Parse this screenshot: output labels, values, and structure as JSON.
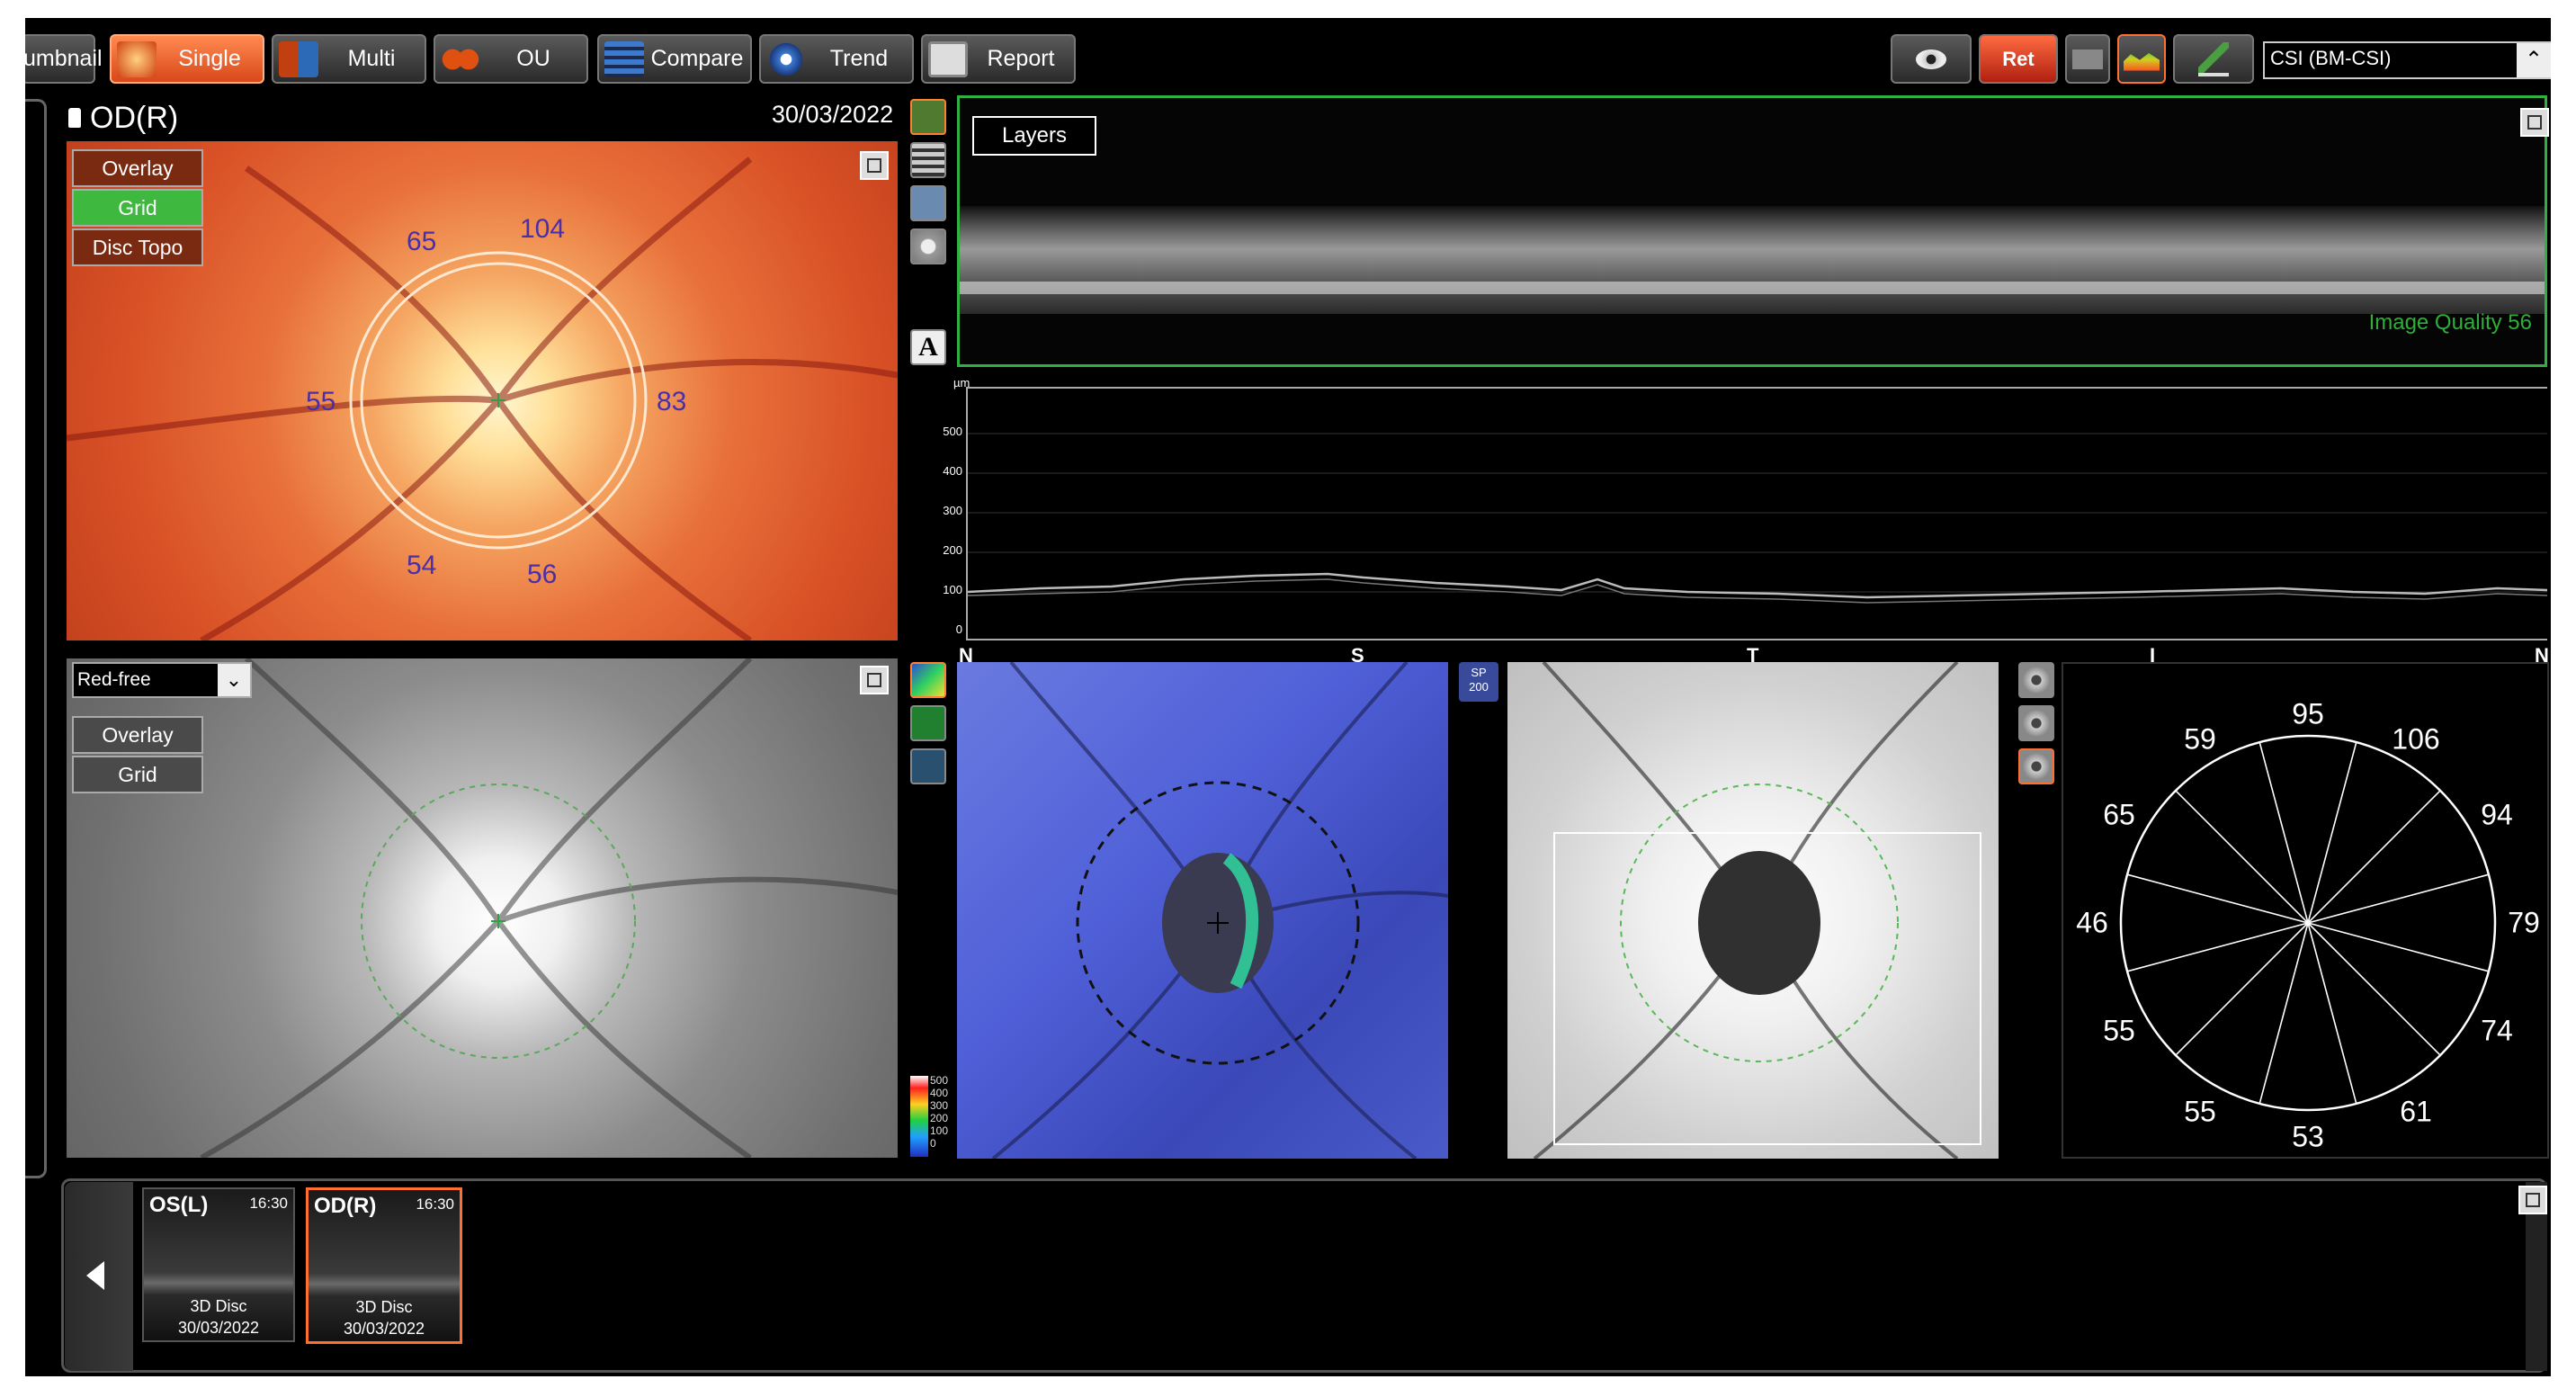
{
  "toolbar": {
    "tabs": [
      {
        "label": "umbnail",
        "active": false
      },
      {
        "label": "Single",
        "active": true
      },
      {
        "label": "Multi",
        "active": false
      },
      {
        "label": "OU",
        "active": false
      },
      {
        "label": "Compare",
        "active": false
      },
      {
        "label": "Trend",
        "active": false
      },
      {
        "label": "Report",
        "active": false
      }
    ],
    "right_icons": [
      "eye-icon",
      "ret-icon",
      "scan-icon",
      "thickness-map-icon",
      "edit-icon"
    ],
    "ret_label": "Ret",
    "select_value": "CSI (BM-CSI)"
  },
  "header": {
    "eye": "OD(R)",
    "date": "30/03/2022"
  },
  "fundus_panel": {
    "buttons": [
      "Overlay",
      "Grid",
      "Disc Topo"
    ],
    "active_button": "Grid",
    "sector_values": {
      "top_left": "65",
      "top_right": "104",
      "left": "55",
      "right": "83",
      "bottom_left": "54",
      "bottom_right": "56"
    }
  },
  "redfree_panel": {
    "dropdown": "Red-free",
    "buttons": [
      "Overlay",
      "Grid"
    ]
  },
  "bscan_panel": {
    "layers_label": "Layers",
    "quality_text": "Image Quality 56"
  },
  "thickness_plot": {
    "unit": "µm",
    "y_ticks": [
      "500",
      "400",
      "300",
      "200",
      "100",
      "0"
    ],
    "x_labels": [
      "N",
      "S",
      "T",
      "I",
      "N"
    ]
  },
  "colorbar": {
    "ticks": [
      "500",
      "400",
      "300",
      "200",
      "100",
      "0"
    ]
  },
  "sp_badge": "SP\n200",
  "clock_chart": {
    "values": [
      "95",
      "106",
      "94",
      "79",
      "74",
      "61",
      "53",
      "55",
      "55",
      "46",
      "65",
      "59"
    ]
  },
  "thumbnails": [
    {
      "eye": "OS(L)",
      "time": "16:30",
      "type": "3D Disc",
      "date": "30/03/2022",
      "selected": false
    },
    {
      "eye": "OD(R)",
      "time": "16:30",
      "type": "3D Disc",
      "date": "30/03/2022",
      "selected": true
    }
  ]
}
